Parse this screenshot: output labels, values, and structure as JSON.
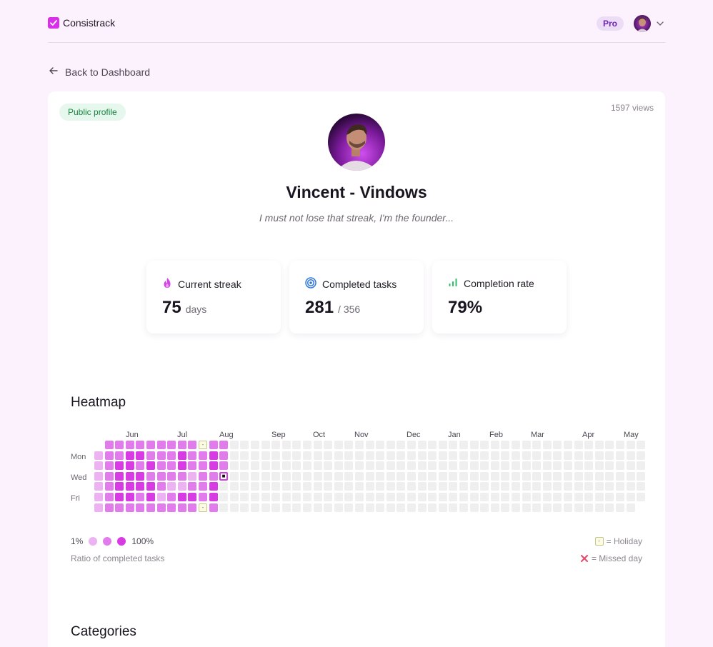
{
  "app": {
    "name": "Consistrack",
    "plan_badge": "Pro"
  },
  "nav": {
    "back_label": "Back to Dashboard"
  },
  "profile": {
    "visibility_badge": "Public profile",
    "views": "1597 views",
    "name": "Vincent - Vindows",
    "tagline": "I must not lose that streak, I'm the founder..."
  },
  "stats": {
    "streak": {
      "label": "Current streak",
      "value": "75",
      "unit": "days",
      "icon": "flame-icon"
    },
    "tasks": {
      "label": "Completed tasks",
      "value": "281",
      "unit": "/ 356",
      "icon": "target-icon"
    },
    "rate": {
      "label": "Completion rate",
      "value": "79%",
      "icon": "bar-chart-icon"
    }
  },
  "heatmap": {
    "title": "Heatmap",
    "months": [
      "Jun",
      "Jul",
      "Aug",
      "Sep",
      "Oct",
      "Nov",
      "Dec",
      "Jan",
      "Feb",
      "Mar",
      "Apr",
      "May"
    ],
    "day_labels": [
      "Mon",
      "Wed",
      "Fri"
    ],
    "legend": {
      "min": "1%",
      "max": "100%",
      "caption": "Ratio of completed tasks",
      "holiday": "= Holiday",
      "missed": "= Missed day"
    },
    "legend_colors": [
      "#ecb2f2",
      "#e27cec",
      "#d83ae4"
    ],
    "colors": {
      "empty": "#efefef",
      "level1": "#ecb2f2",
      "level2": "#e27cec",
      "level3": "#d83ae4",
      "today_border": "#d83ae4"
    },
    "weeks": 53,
    "active_weeks": [
      [
        null,
        1,
        1,
        1,
        1,
        1,
        1
      ],
      [
        2,
        2,
        2,
        2,
        2,
        2,
        2
      ],
      [
        2,
        2,
        3,
        3,
        3,
        3,
        2
      ],
      [
        2,
        3,
        3,
        3,
        3,
        3,
        2
      ],
      [
        2,
        3,
        2,
        3,
        3,
        2,
        2
      ],
      [
        2,
        2,
        3,
        2,
        3,
        3,
        2
      ],
      [
        2,
        2,
        2,
        2,
        2,
        1,
        2
      ],
      [
        2,
        2,
        2,
        2,
        1,
        2,
        2
      ],
      [
        2,
        3,
        3,
        2,
        1,
        3,
        2
      ],
      [
        2,
        2,
        2,
        1,
        2,
        3,
        2
      ],
      [
        "H",
        2,
        2,
        2,
        2,
        2,
        "H"
      ],
      [
        2,
        3,
        3,
        2,
        3,
        3,
        2
      ],
      [
        2,
        2,
        2,
        "T",
        null,
        null,
        null
      ]
    ],
    "today_mark": "■",
    "holiday_mark": "-"
  },
  "categories": {
    "title": "Categories"
  }
}
